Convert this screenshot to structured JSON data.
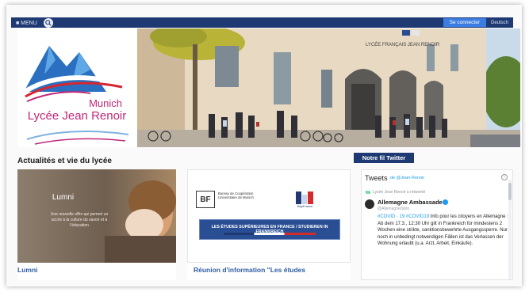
{
  "topbar": {
    "left_label": "■ MENU",
    "cta_label": "Se connecter",
    "lang_label": "Deutsch"
  },
  "logo": {
    "city": "Munich",
    "school": "Lycée Jean Renoir"
  },
  "hero": {
    "building_sign": "LYCÉE FRANÇAIS JEAN RENOIR"
  },
  "news": {
    "section_title": "Actualités et vie du lycée",
    "cards": [
      {
        "title": "Lumni",
        "image_word": "Lumni",
        "image_caption": "Une nouvelle offre qui permet un accès à la culture du savoir et à l'éducation"
      },
      {
        "title": "Réunion d'information \"Les études",
        "bf_letters": "BF",
        "bf_text": "Bureau de Coopération Universitaire de Munich",
        "partner_name": "BayFrance",
        "banner_text": "LES ÉTUDES SUPÉRIEURES EN FRANCE / STUDIEREN IN FRANKREICH"
      }
    ]
  },
  "twitter": {
    "button_label": "Notre fil Twitter",
    "widget_title": "Tweets",
    "widget_by": "de @Jean-Renoir",
    "retweet_line": "Lycée Jean Renoir a retweeté",
    "author": "Allemagne Ambassade",
    "handle": "@AllemagneDiplo",
    "body_tags": "#COVID · 19 #COVID19",
    "body_text": "Info pour les citoyens en Allemagne : Ab dem 17.3., 12:30 Uhr gilt in Frankreich für mindestens 2 Wochen eine strikte, sanktionsbewehrte Ausgangssperre. Nur noch in unbedingt notwendigen Fällen ist das Verlassen der Wohnung erlaubt (u.a. Arzt, Arbeit, Einkäufe)."
  },
  "colors": {
    "navy": "#1f3a73",
    "accent_blue": "#2f5da6",
    "magenta": "#c0287a",
    "twitter_blue": "#1d9bf0"
  }
}
